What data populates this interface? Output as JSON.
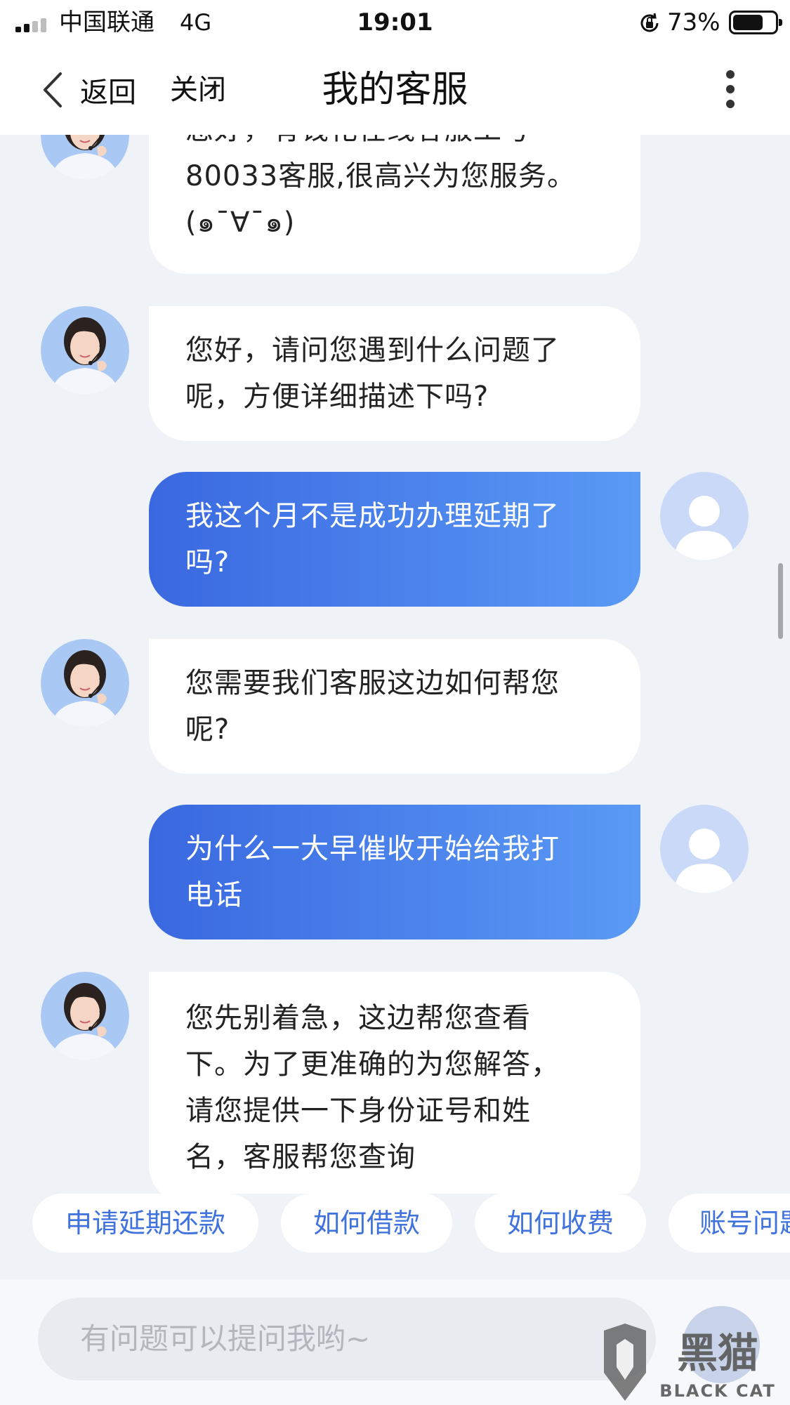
{
  "status_bar": {
    "carrier": "中国联通",
    "network": "4G",
    "time": "19:01",
    "battery": "73%",
    "battery_level": 0.73
  },
  "nav": {
    "back_label": "返回",
    "close_label": "关闭",
    "title": "我的客服"
  },
  "messages": [
    {
      "from": "agent",
      "lines": [
        "您好，有钱花在线客服工号",
        "80033客服,很高兴为您服务。",
        "(๑¯∀¯๑)"
      ]
    },
    {
      "from": "agent",
      "lines": [
        "您好，请问您遇到什么问题了",
        "呢，方便详细描述下吗?"
      ]
    },
    {
      "from": "user",
      "lines": [
        "我这个月不是成功办理延期了",
        "吗?"
      ]
    },
    {
      "from": "agent",
      "lines": [
        "您需要我们客服这边如何帮您",
        "呢?"
      ]
    },
    {
      "from": "user",
      "lines": [
        "为什么一大早催收开始给我打",
        "电话"
      ]
    },
    {
      "from": "agent",
      "lines": [
        "您先别着急，这边帮您查看",
        "下。为了更准确的为您解答，",
        "请您提供一下身份证号和姓",
        "名，客服帮您查询"
      ]
    }
  ],
  "quick_replies": [
    "申请延期还款",
    "如何借款",
    "如何收费",
    "账号问题"
  ],
  "input": {
    "placeholder": "有问题可以提问我哟~"
  },
  "watermark": {
    "name": "黑猫",
    "brand": "BLACK CAT"
  },
  "colors": {
    "accent": "#3f72dd",
    "user_bubble_start": "#3a68e0",
    "user_bubble_end": "#5a9af5",
    "background": "#eff2f7"
  },
  "icons": {
    "back": "chevron-left-icon",
    "more": "more-vertical-icon",
    "agent_avatar": "agent-avatar",
    "user_avatar": "user-avatar",
    "lock": "rotation-lock-icon"
  }
}
